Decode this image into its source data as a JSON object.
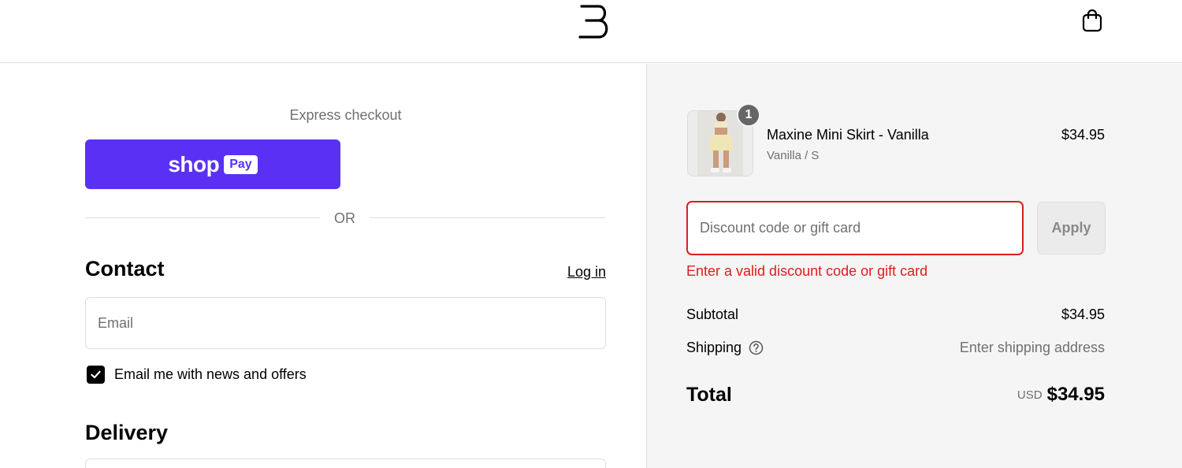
{
  "header": {
    "logo_icon": "brand-monogram-logo",
    "cart_icon": "shopping-bag-icon"
  },
  "checkout": {
    "express_label": "Express checkout",
    "shop_pay": {
      "shop_word": "shop",
      "pay_word": "Pay",
      "brand_color": "#5a31f4"
    },
    "or_label": "OR",
    "contact": {
      "heading": "Contact",
      "login_link": "Log in",
      "email_placeholder": "Email",
      "email_value": "",
      "newsletter_label": "Email me with news and offers",
      "newsletter_checked": true
    },
    "delivery": {
      "heading": "Delivery"
    }
  },
  "summary": {
    "product": {
      "name": "Maxine Mini Skirt - Vanilla",
      "variant": "Vanilla / S",
      "price": "$34.95",
      "quantity": "1"
    },
    "discount": {
      "placeholder": "Discount code or gift card",
      "value": "",
      "apply_label": "Apply",
      "error": "Enter a valid discount code or gift card",
      "error_color": "#dd1d1d"
    },
    "subtotal_label": "Subtotal",
    "subtotal_value": "$34.95",
    "shipping_label": "Shipping",
    "shipping_value": "Enter shipping address",
    "total_label": "Total",
    "total_currency": "USD",
    "total_value": "$34.95"
  }
}
